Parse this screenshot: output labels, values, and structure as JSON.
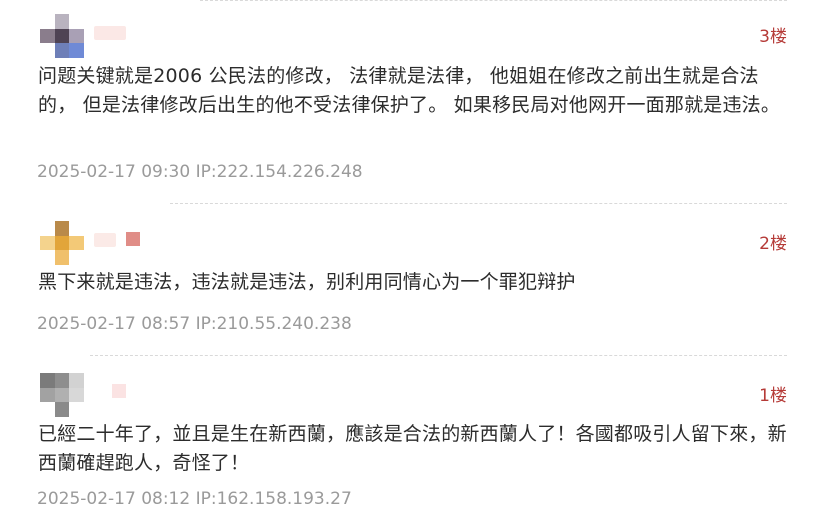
{
  "comments": [
    {
      "floor": "3楼",
      "text": "问题关键就是2006 公民法的修改， 法律就是法律， 他姐姐在修改之前出生就是合法的， 但是法律修改后出生的他不受法律保护了。 如果移民局对他网开一面那就是违法。",
      "time": "2025-02-17 09:30",
      "ip": "IP:222.154.226.248",
      "colors": {
        "avatar": [
          "#ffffff",
          "#b9b3bf",
          "#ffffff",
          "#8a7d8c",
          "#4f4354",
          "#a9a0b5",
          "#ffffff",
          "#6e7fb8",
          "#6f8ad6"
        ],
        "nick": "#fbe8e6"
      }
    },
    {
      "floor": "2楼",
      "text": "黑下来就是违法，违法就是违法，别利用同情心为一个罪犯辩护",
      "time": "2025-02-17 08:57",
      "ip": "IP:210.55.240.238",
      "colors": {
        "avatar": [
          "#ffffff",
          "#b98a4a",
          "#ffffff",
          "#f4d38d",
          "#e2a53a",
          "#f3c977",
          "#ffffff",
          "#f0c06c",
          "#ffffff"
        ],
        "nick": "#fbeae7",
        "dot": "#e08d87"
      }
    },
    {
      "floor": "1楼",
      "text": "已經二十年了，並且是生在新西蘭，應該是合法的新西蘭人了！各國都吸引人留下來，新西蘭確趕跑人，奇怪了！",
      "time": "2025-02-17 08:12",
      "ip": "IP:162.158.193.27",
      "colors": {
        "avatar": [
          "#7b7b7b",
          "#8e8e8e",
          "#d2d2d2",
          "#a2a2a2",
          "#b0b0b0",
          "#d8d8d8",
          "#ffffff",
          "#8a8a8a",
          "#ffffff"
        ],
        "nick": "#ffffff",
        "dot": "#fbe3e3"
      }
    }
  ]
}
